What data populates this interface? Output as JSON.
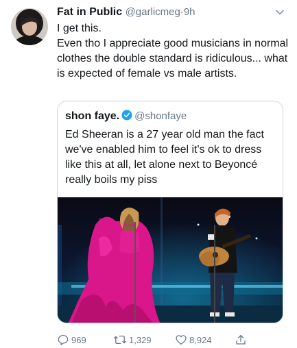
{
  "tweet": {
    "author_name": "Fat in Public",
    "handle": "@garlicmeg",
    "separator": "·",
    "time": "9h",
    "text_lines": [
      "I get this.",
      "Even tho I appreciate good musicians in normal clothes the double standard is ridiculous... what is expected of female vs male artists."
    ]
  },
  "quoted": {
    "author_name": "shon faye.",
    "handle": "@shonfaye",
    "text": "Ed Sheeran is a 27 year old man the fact we've enabled him to feel it's ok to dress like this at all, let alone next to Beyoncé really boils my piss"
  },
  "actions": {
    "replies": "969",
    "retweets": "1,329",
    "likes": "8,924"
  },
  "colors": {
    "text": "#14171a",
    "secondary": "#657786",
    "verified": "#1da1f2",
    "border": "#ccd6dd"
  },
  "icons": [
    "chevron-down-icon",
    "verified-badge-icon",
    "reply-icon",
    "retweet-icon",
    "like-icon",
    "share-icon"
  ]
}
